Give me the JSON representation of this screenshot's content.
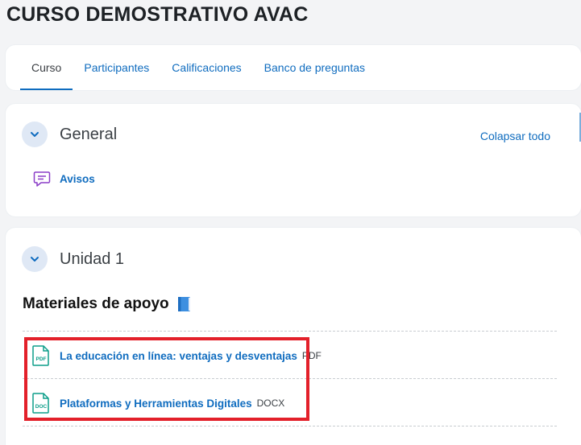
{
  "page": {
    "title": "CURSO DEMOSTRATIVO AVAC"
  },
  "tabs": [
    {
      "label": "Curso",
      "active": true
    },
    {
      "label": "Participantes"
    },
    {
      "label": "Calificaciones"
    },
    {
      "label": "Banco de preguntas"
    }
  ],
  "general": {
    "title": "General",
    "collapse_all": "Colapsar todo",
    "activities": [
      {
        "label": "Avisos",
        "icon": "forum-icon"
      }
    ]
  },
  "unidad1": {
    "title": "Unidad 1",
    "subheading": "Materiales de apoyo",
    "files": [
      {
        "label": "La educación en línea: ventajas y desventajas",
        "type": "PDF",
        "icon": "pdf-file-icon",
        "icon_text": "PDF"
      },
      {
        "label": "Plataformas y Herramientas Digitales",
        "type": "DOCX",
        "icon": "doc-file-icon",
        "icon_text": "DOC"
      }
    ]
  },
  "colors": {
    "link": "#0f6cbf",
    "highlight": "#e3202a",
    "icon_teal": "#0d9e8a",
    "forum_purple": "#8a3cc7"
  }
}
